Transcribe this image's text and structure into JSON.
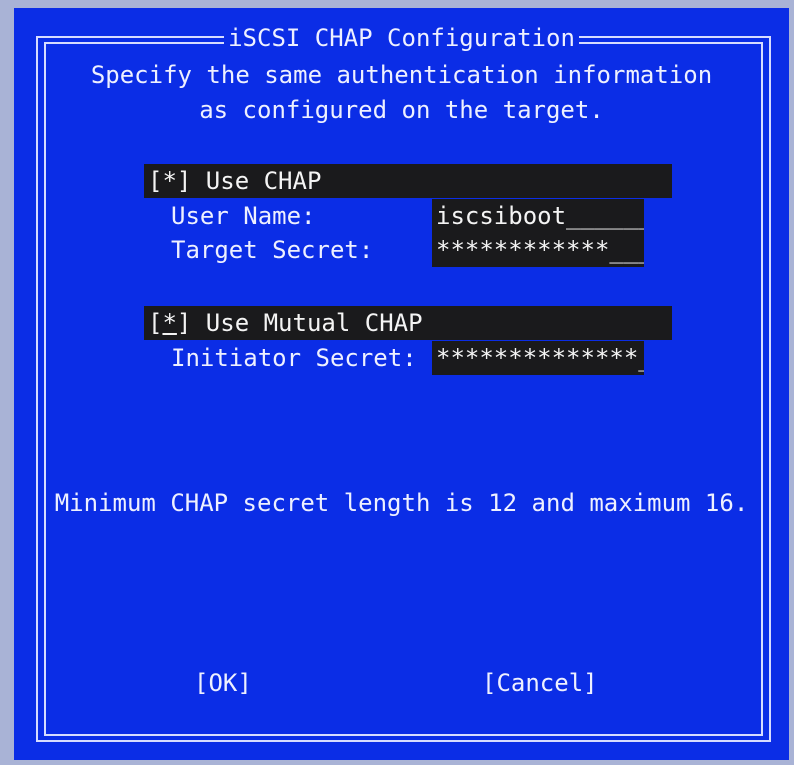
{
  "dialog": {
    "title": "iSCSI CHAP Configuration",
    "description_line1": "Specify the same authentication information",
    "description_line2": "as configured on the target."
  },
  "use_chap": {
    "label": "[*] Use CHAP",
    "checked": true
  },
  "user_name": {
    "label": "User Name:",
    "value": "iscsiboot_______"
  },
  "target_secret": {
    "label": "Target Secret:",
    "value": "************____"
  },
  "use_mutual_chap": {
    "checkbox_open": "[",
    "checkbox_mark": "*",
    "checkbox_rest": "] Use Mutual CHAP",
    "checked": true
  },
  "initiator_secret": {
    "label": "Initiator Secret:",
    "value": "**************__"
  },
  "note": "Minimum CHAP secret length is 12 and maximum 16.",
  "buttons": {
    "ok": "[OK]",
    "cancel": "[Cancel]"
  },
  "colors": {
    "background": "#0b2de6",
    "field": "#1a1a1c",
    "text": "#eef0ff"
  }
}
